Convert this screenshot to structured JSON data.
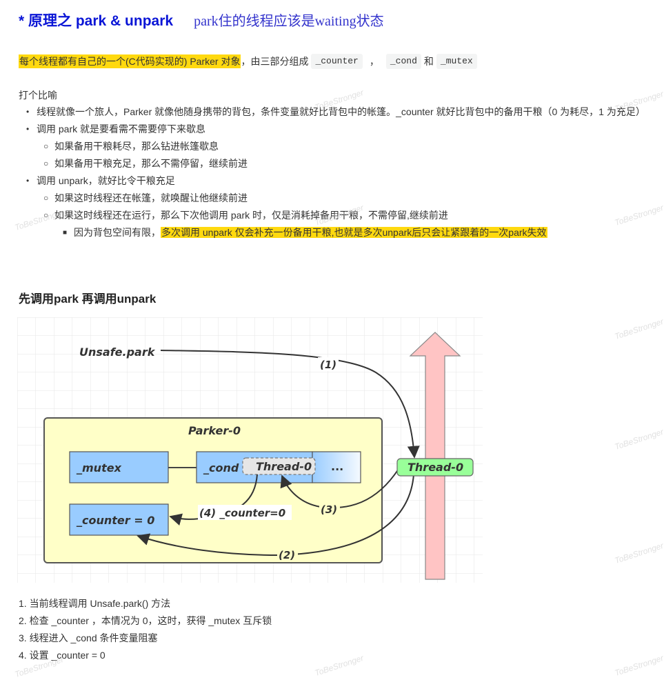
{
  "title": {
    "heading": "* 原理之 park & unpark",
    "annotation": "park住的线程应该是waiting状态"
  },
  "intro": {
    "highlight": "每个线程都有自己的一个(C代码实现的) Parker 对象",
    "text1": "，由三部分组成",
    "code1": "_counter",
    "sep": "，",
    "code2": "_cond",
    "and": "和",
    "code3": "_mutex"
  },
  "analogy": {
    "title": "打个比喻",
    "items": [
      {
        "level": 1,
        "bullet": "•",
        "text": "线程就像一个旅人，Parker 就像他随身携带的背包，条件变量就好比背包中的帐篷。_counter 就好比背包中的备用干粮（0 为耗尽，1 为充足）"
      },
      {
        "level": 1,
        "bullet": "•",
        "text": "调用 park 就是要看需不需要停下来歇息"
      },
      {
        "level": 2,
        "bullet": "○",
        "text": "如果备用干粮耗尽，那么钻进帐篷歇息"
      },
      {
        "level": 2,
        "bullet": "○",
        "text": "如果备用干粮充足，那么不需停留，继续前进"
      },
      {
        "level": 1,
        "bullet": "•",
        "text": "调用 unpark，就好比令干粮充足"
      },
      {
        "level": 2,
        "bullet": "○",
        "text": "如果这时线程还在帐篷，就唤醒让他继续前进"
      },
      {
        "level": 2,
        "bullet": "○",
        "text": "如果这时线程还在运行，那么下次他调用 park 时，仅是消耗掉备用干粮，不需停留,继续前进"
      },
      {
        "level": 3,
        "bullet": "■",
        "text": "因为背包空间有限，",
        "highlight": "多次调用 unpark 仅会补充一份备用干粮,也就是多次unpark后只会让紧跟着的一次park失效"
      }
    ]
  },
  "section": {
    "heading": "先调用park 再调用unpark"
  },
  "diagram": {
    "unsafe_park": "Unsafe.park",
    "parker": "Parker-0",
    "mutex": "_mutex",
    "cond": "_cond",
    "cond_thread": "Thread-0",
    "cond_more": "...",
    "counter": "_counter = 0",
    "thread": "Thread-0",
    "label_1": "(1)",
    "label_2": "(2)",
    "label_3": "(3)",
    "label_4": "(4) _counter=0",
    "colors": {
      "parker_fill": "#ffffc8",
      "field_fill": "#99ccff",
      "thread_fill": "#99ff99",
      "arrow_fill": "#ffc4c4",
      "grid": "#e8e8e8"
    }
  },
  "steps": [
    "1. 当前线程调用 Unsafe.park() 方法",
    "2. 检查 _counter ，本情况为 0，这时，获得 _mutex 互斥锁",
    "3. 线程进入 _cond 条件变量阻塞",
    "4. 设置 _counter = 0"
  ],
  "watermark": "ToBeStronger"
}
